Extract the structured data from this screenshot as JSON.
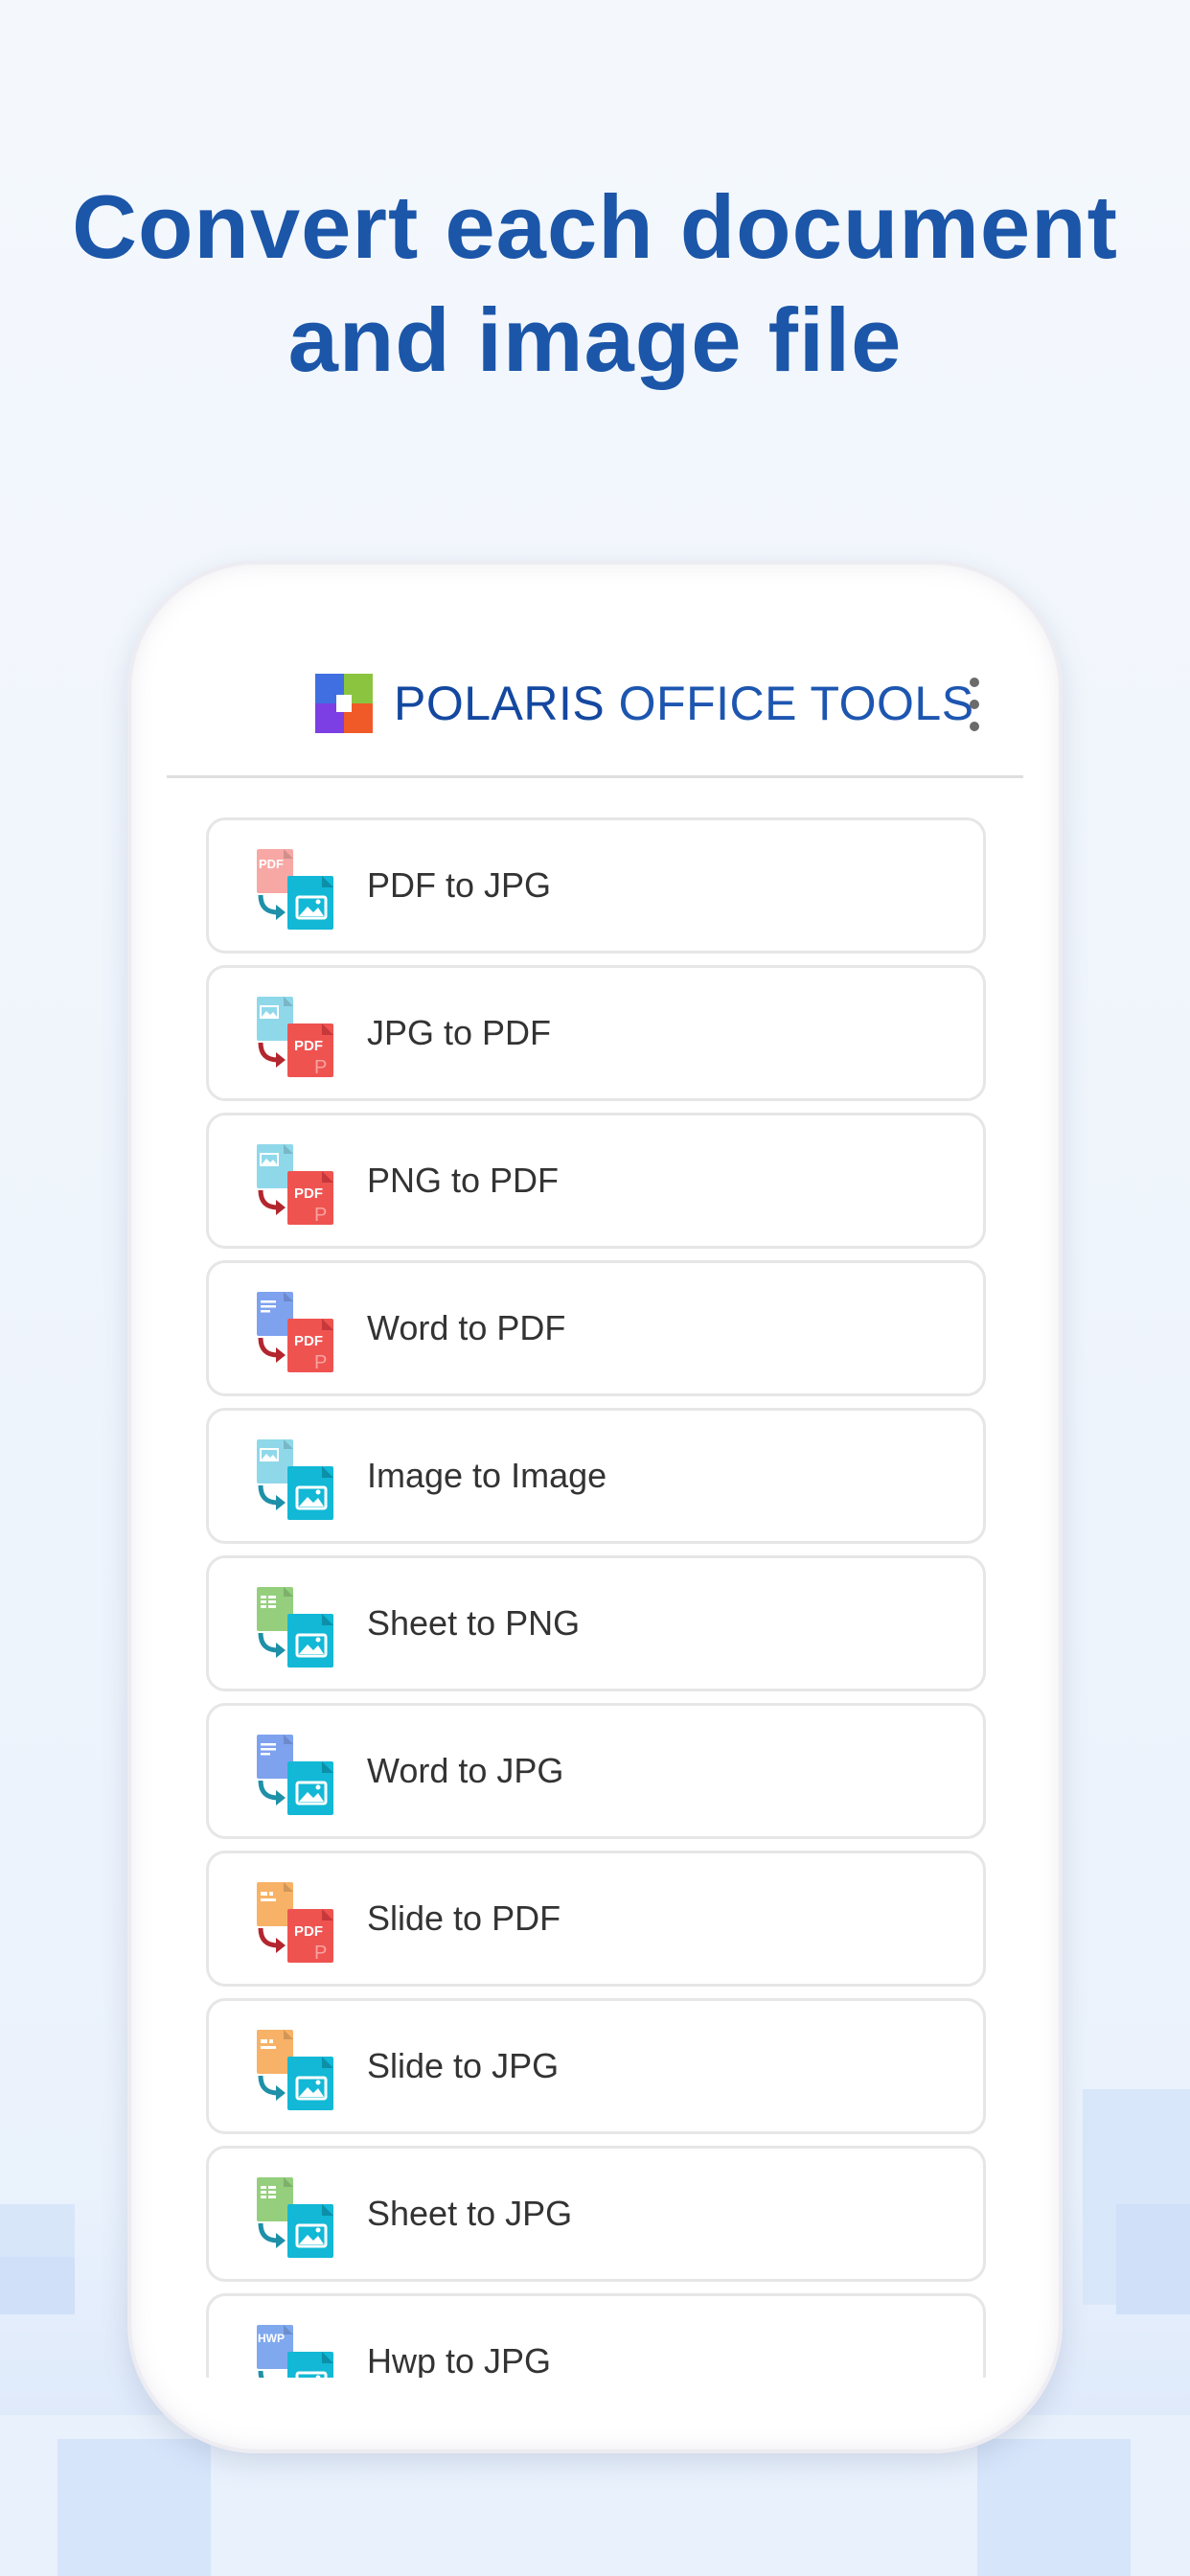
{
  "headline": {
    "line1": "Convert each document",
    "line2": "and image file"
  },
  "app": {
    "brand_bold": "POLARIS",
    "brand_light": "OFFICE TOOLS",
    "logo_colors": [
      "#8bc53f",
      "#00a3e0",
      "#7b3fe4",
      "#f05a28"
    ],
    "menu_icon": "more-vertical-icon"
  },
  "colors": {
    "headline": "#1b56a9",
    "pdf_red": "#ef5350",
    "image_cyan": "#12b8d6",
    "arrow_cyan": "#1e90a8",
    "arrow_red": "#b3262e"
  },
  "tools": [
    {
      "label": "PDF to JPG",
      "source": "pdf",
      "target": "image"
    },
    {
      "label": "JPG to PDF",
      "source": "image",
      "target": "pdf"
    },
    {
      "label": "PNG to PDF",
      "source": "image",
      "target": "pdf"
    },
    {
      "label": "Word to PDF",
      "source": "word",
      "target": "pdf"
    },
    {
      "label": "Image to Image",
      "source": "image",
      "target": "image"
    },
    {
      "label": "Sheet to PNG",
      "source": "sheet",
      "target": "image"
    },
    {
      "label": "Word to JPG",
      "source": "word",
      "target": "image"
    },
    {
      "label": "Slide to PDF",
      "source": "slide",
      "target": "pdf"
    },
    {
      "label": "Slide to JPG",
      "source": "slide",
      "target": "image"
    },
    {
      "label": "Sheet to JPG",
      "source": "sheet",
      "target": "image"
    },
    {
      "label": "Hwp to JPG",
      "source": "hwp",
      "target": "image"
    }
  ]
}
